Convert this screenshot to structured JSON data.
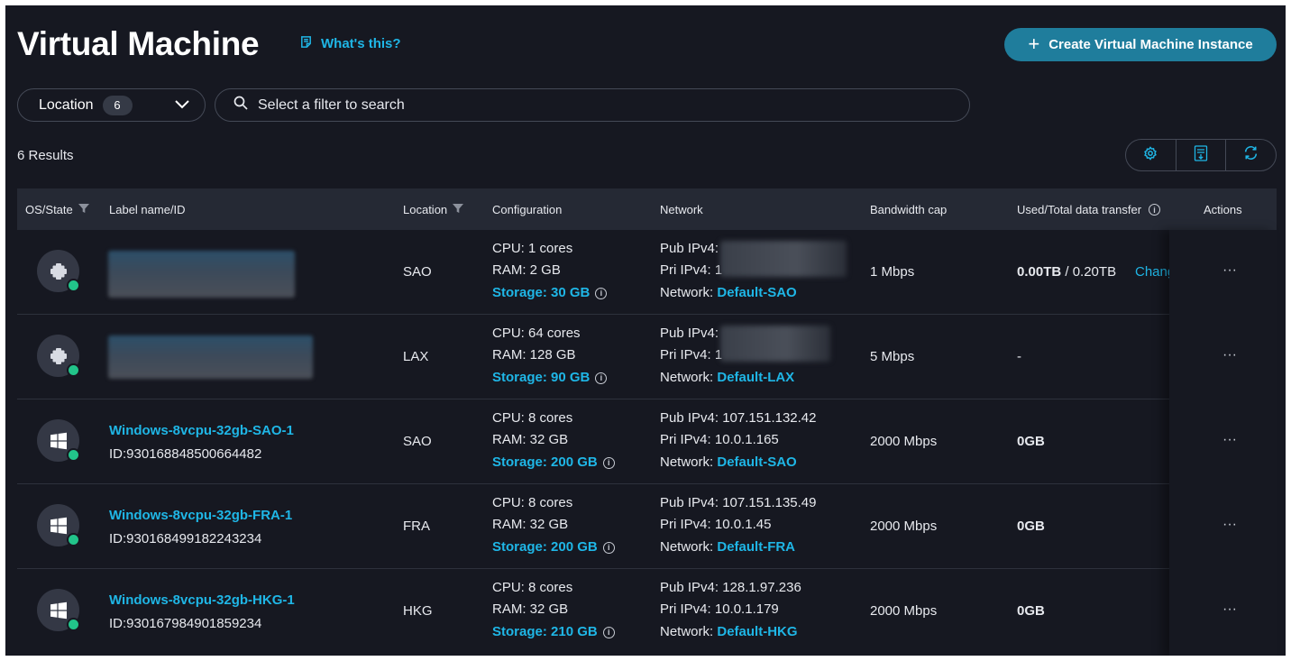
{
  "header": {
    "title": "Virtual Machine",
    "whats_this": "What's this?",
    "create_button": "Create Virtual Machine Instance"
  },
  "filters": {
    "location_label": "Location",
    "location_count": "6",
    "search_placeholder": "Select a filter to search"
  },
  "results_label": "6 Results",
  "toolbar": {
    "buttons": [
      "settings-icon",
      "csv-download-icon",
      "refresh-icon"
    ]
  },
  "table": {
    "columns": [
      "OS/State",
      "Label name/ID",
      "Location",
      "Configuration",
      "Network",
      "Bandwidth cap",
      "Used/Total data transfer",
      "Actions"
    ],
    "rows": [
      {
        "os": "linux-icon",
        "name": "",
        "id": "",
        "location": "SAO",
        "cpu": "CPU: 1 cores",
        "ram": "RAM: 2 GB",
        "storage": "Storage: 30 GB",
        "pub_label": "Pub IPv4:",
        "pub_ip": "",
        "pri_label": "Pri IPv4:",
        "pri_ip": "1",
        "network_label": "Network:",
        "network": "Default-SAO",
        "bandwidth": "1 Mbps",
        "transfer_used": "0.00TB",
        "transfer_rest": " / 0.20TB",
        "transfer_change": "Chang"
      },
      {
        "os": "linux-icon",
        "name": "",
        "id": "",
        "location": "LAX",
        "cpu": "CPU: 64 cores",
        "ram": "RAM: 128 GB",
        "storage": "Storage: 90 GB",
        "pub_label": "Pub IPv4:",
        "pub_ip": "",
        "pri_label": "Pri IPv4:",
        "pri_ip": "1",
        "network_label": "Network:",
        "network": "Default-LAX",
        "bandwidth": "5 Mbps",
        "transfer_used": "-",
        "transfer_rest": "",
        "transfer_change": ""
      },
      {
        "os": "windows-icon",
        "name": "Windows-8vcpu-32gb-SAO-1",
        "id": "ID:930168848500664482",
        "location": "SAO",
        "cpu": "CPU: 8 cores",
        "ram": "RAM: 32 GB",
        "storage": "Storage: 200 GB",
        "pub_label": "Pub IPv4:",
        "pub_ip": "107.151.132.42",
        "pri_label": "Pri IPv4:",
        "pri_ip": "10.0.1.165",
        "network_label": "Network:",
        "network": "Default-SAO",
        "bandwidth": "2000 Mbps",
        "transfer_used": "0GB",
        "transfer_rest": "",
        "transfer_change": ""
      },
      {
        "os": "windows-icon",
        "name": "Windows-8vcpu-32gb-FRA-1",
        "id": "ID:930168499182243234",
        "location": "FRA",
        "cpu": "CPU: 8 cores",
        "ram": "RAM: 32 GB",
        "storage": "Storage: 200 GB",
        "pub_label": "Pub IPv4:",
        "pub_ip": "107.151.135.49",
        "pri_label": "Pri IPv4:",
        "pri_ip": "10.0.1.45",
        "network_label": "Network:",
        "network": "Default-FRA",
        "bandwidth": "2000 Mbps",
        "transfer_used": "0GB",
        "transfer_rest": "",
        "transfer_change": ""
      },
      {
        "os": "windows-icon",
        "name": "Windows-8vcpu-32gb-HKG-1",
        "id": "ID:930167984901859234",
        "location": "HKG",
        "cpu": "CPU: 8 cores",
        "ram": "RAM: 32 GB",
        "storage": "Storage: 210 GB",
        "pub_label": "Pub IPv4:",
        "pub_ip": "128.1.97.236",
        "pri_label": "Pri IPv4:",
        "pri_ip": "10.0.1.179",
        "network_label": "Network:",
        "network": "Default-HKG",
        "bandwidth": "2000 Mbps",
        "transfer_used": "0GB",
        "transfer_rest": "",
        "transfer_change": ""
      }
    ],
    "actions_glyph": "···"
  },
  "colors": {
    "background": "#161821",
    "header_bg": "#252934",
    "accent": "#1fb6e6",
    "button": "#1f7d9c",
    "status_running": "#22c48a"
  }
}
